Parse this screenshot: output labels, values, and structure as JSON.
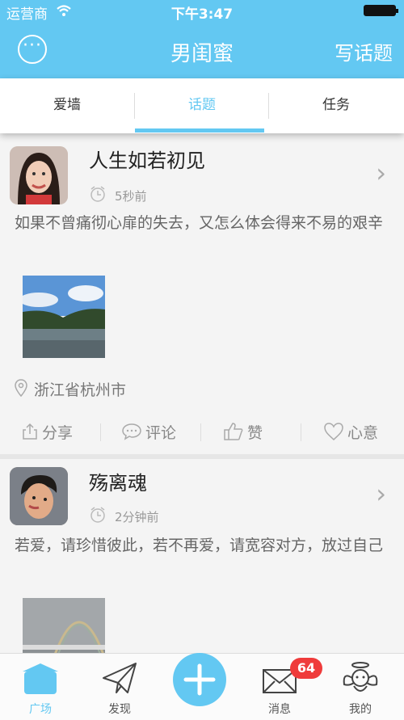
{
  "status_bar": {
    "carrier": "运营商",
    "time": "下午3:47"
  },
  "nav": {
    "title": "男闺蜜",
    "write_label": "写话题",
    "more_icon": "more-icon"
  },
  "tabs": [
    {
      "label": "爱墙",
      "active": false
    },
    {
      "label": "话题",
      "active": true
    },
    {
      "label": "任务",
      "active": false
    }
  ],
  "posts": [
    {
      "name": "人生如若初见",
      "time_ago": "5秒前",
      "content": "如果不曾痛彻心扉的失去，又怎么体会得来不易的艰辛",
      "location": "浙江省杭州市",
      "actions": {
        "share": "分享",
        "comment": "评论",
        "like": "赞",
        "wish": "心意"
      }
    },
    {
      "name": "殇离魂",
      "time_ago": "2分钟前",
      "content": "若爱，请珍惜彼此，若不再爱，请宽容对方，放过自己"
    }
  ],
  "tabbar": {
    "items": [
      {
        "label": "广场",
        "icon": "plaza-icon",
        "active": true
      },
      {
        "label": "发现",
        "icon": "paper-plane-icon",
        "active": false
      },
      {
        "label": "消息",
        "icon": "envelope-icon",
        "active": false
      },
      {
        "label": "我的",
        "icon": "angel-icon",
        "active": false
      }
    ],
    "message_badge": "64"
  },
  "colors": {
    "accent": "#63c8f2",
    "badge": "#ef3b3b"
  }
}
